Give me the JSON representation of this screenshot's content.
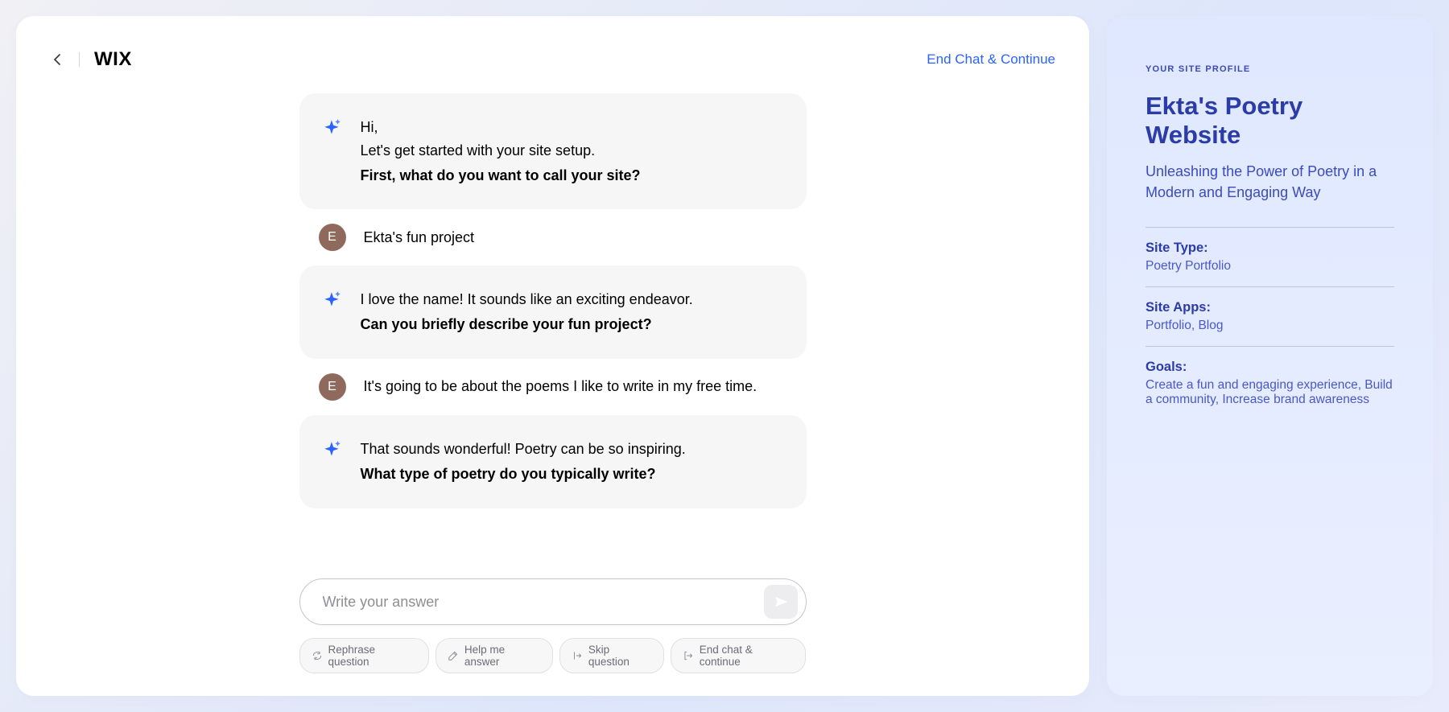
{
  "header": {
    "logo": "WIX",
    "end_chat_label": "End Chat & Continue"
  },
  "chat": {
    "messages": [
      {
        "role": "ai",
        "line1": "Hi,",
        "line2": "Let's get started with your site setup.",
        "bold": "First, what do you want to call your site?"
      },
      {
        "role": "user",
        "initial": "E",
        "text": "Ekta's fun project"
      },
      {
        "role": "ai",
        "line1": "I love the name! It sounds like an exciting endeavor.",
        "bold": "Can you briefly describe your fun project?"
      },
      {
        "role": "user",
        "initial": "E",
        "text": "It's going to be about the poems I like to write in my free time."
      },
      {
        "role": "ai",
        "line1": "That sounds wonderful! Poetry can be so inspiring.",
        "bold": "What type of poetry do you typically write?"
      }
    ]
  },
  "composer": {
    "placeholder": "Write your answer"
  },
  "actions": {
    "rephrase": "Rephrase question",
    "help": "Help me answer",
    "skip": "Skip question",
    "end": "End chat & continue"
  },
  "profile": {
    "eyebrow": "YOUR SITE PROFILE",
    "title": "Ekta's Poetry Website",
    "subtitle": "Unleashing the Power of Poetry in a Modern and Engaging Way",
    "sections": [
      {
        "label": "Site Type:",
        "value": "Poetry Portfolio"
      },
      {
        "label": "Site Apps:",
        "value": "Portfolio, Blog"
      },
      {
        "label": "Goals:",
        "value": "Create a fun and engaging experience, Build a community, Increase brand awareness"
      }
    ]
  }
}
